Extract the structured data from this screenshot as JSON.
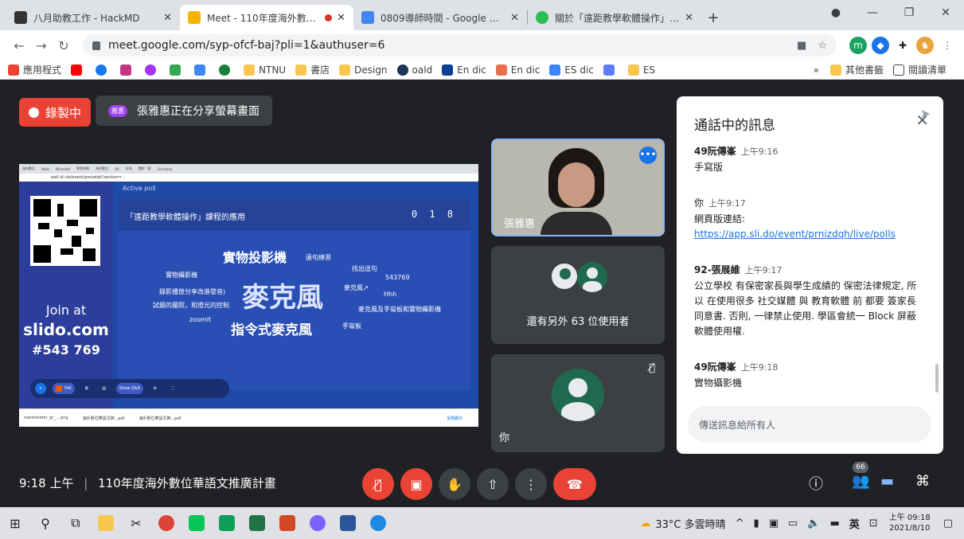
{
  "browser": {
    "tabs": [
      {
        "label": "八月助教工作 - HackMD",
        "color": "#333333"
      },
      {
        "label": "Meet - 110年度海外數位華",
        "color": "#f4b400"
      },
      {
        "label": "0809導師時間 - Google 文件",
        "color": "#4285f4"
      },
      {
        "label": "關於「遠距教學軟體操作」課程",
        "color": "#2bbd56"
      }
    ],
    "url": "meet.google.com/syp-ofcf-baj?pli=1&authuser=6",
    "bookmarks": [
      "應用程式",
      "NTNU",
      "書店",
      "Design",
      "oald",
      "En dic",
      "En dic",
      "ES dic",
      "ES"
    ],
    "bookmarks_right": [
      "其他書籤",
      "閱讀清單"
    ]
  },
  "meet": {
    "recording_label": "錄製中",
    "presenter_badge": "雅惠",
    "sharing_text": "張雅惠正在分享螢幕畫面",
    "clock": "9:18 上午",
    "meeting_title": "110年度海外數位華語文推廣計畫",
    "participant_count": "66",
    "accent": "#8ab4f8",
    "danger": "#ea4335"
  },
  "shared_screen": {
    "tabs": [
      "海外數位",
      "Meet",
      "Microsoft",
      "學習與教",
      "海外數位",
      "VR",
      "台灣",
      "關於「遠",
      "Socrative"
    ],
    "url": "wall.sli.do/event/pmizdqh?section=...",
    "active_poll": "Active poll",
    "join_at": "Join at",
    "join_site": "slido.com",
    "join_code": "#543 769",
    "poll_title": "「遠距教學軟體操作」課程的應用",
    "poll_count": "0 1 8",
    "words": [
      "實物投影機",
      "麥克風",
      "指令式麥克風",
      "實物攝影機",
      "錄影播放分享改進發音)",
      "試鏡的擺照，和燈光的控制",
      "zoomit",
      "遠句練習",
      "找出這句",
      "麥克風↗",
      "543769",
      "Hhh",
      "麥克風及手寫板和實物攝影機",
      "手寫板"
    ],
    "controls": [
      "Poll",
      "Show Q&A"
    ],
    "downloads": [
      "mentimeter_qr_....png",
      "海外數位華語文推...pdf",
      "海外數位華語文推...pdf",
      "全部顯示"
    ]
  },
  "tiles": {
    "presenter_name": "張雅惠",
    "others_text": "還有另外 63 位使用者",
    "you_label": "你"
  },
  "chat": {
    "title": "通話中的訊息",
    "messages": [
      {
        "who": "49阮傳峯",
        "time": "上午9:16",
        "text": "手寫版",
        "link": ""
      },
      {
        "who": "你",
        "time": "上午9:17",
        "text": "網頁版連結:",
        "link": "https://app.sli.do/event/prnizdqh/live/polls"
      },
      {
        "who": "92-張展維",
        "time": "上午9:17",
        "text": "公立學校 有保密家長與學生成績的 保密法律規定, 所以 在使用很多 社交媒體 與 教育軟體 前 都要 簽家長同意書. 否則, 一律禁止使用. 學區會統一 Block 屏蔽軟體使用權.",
        "link": ""
      },
      {
        "who": "49阮傳峯",
        "time": "上午9:18",
        "text": "實物攝影機",
        "link": ""
      }
    ],
    "placeholder": "傳送訊息給所有人"
  },
  "taskbar": {
    "weather": "33°C 多雲時晴",
    "ime": "英",
    "time": "上午 09:18",
    "date": "2021/8/10"
  }
}
